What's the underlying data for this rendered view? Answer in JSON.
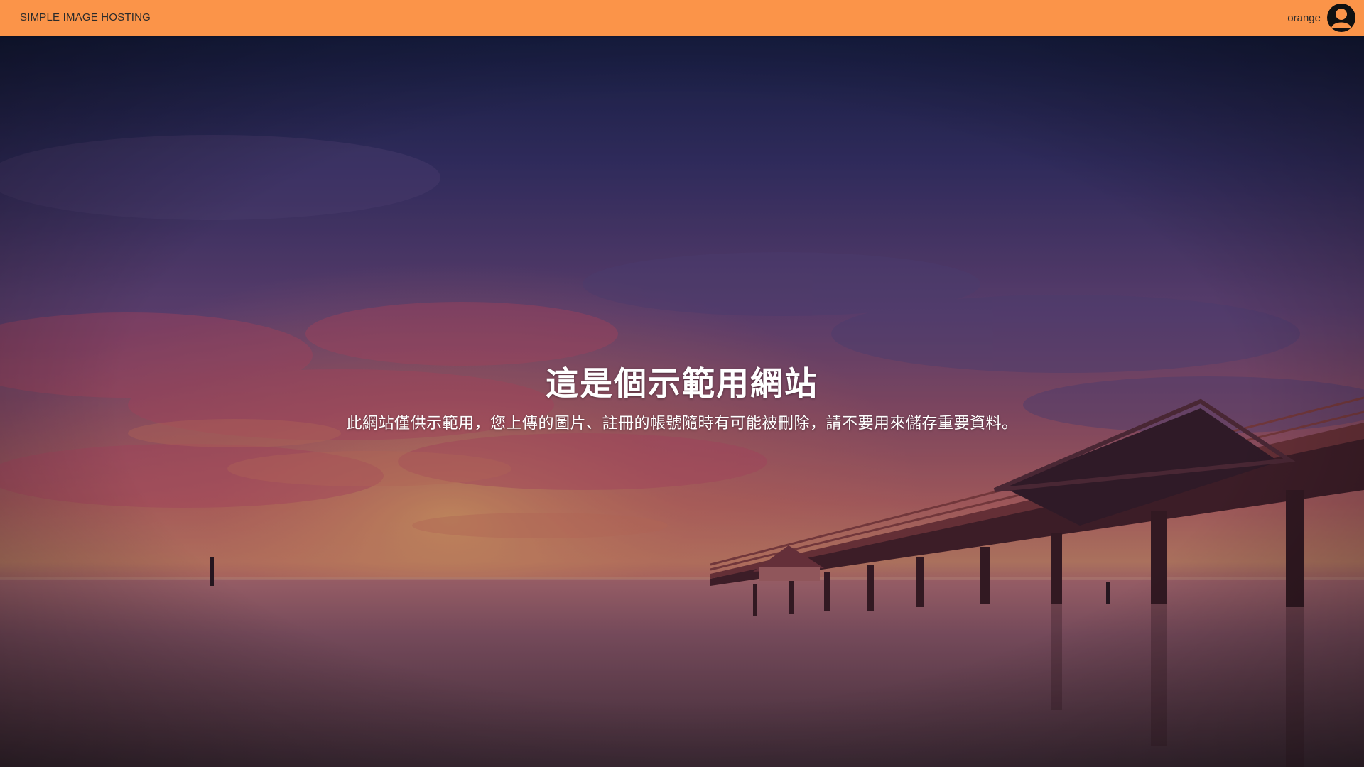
{
  "navbar": {
    "brand": "SIMPLE IMAGE HOSTING",
    "username": "orange",
    "avatar_icon": "user-avatar-icon",
    "background_color": "#fb9449"
  },
  "hero": {
    "title": "這是個示範用網站",
    "subtitle": "此網站僅供示範用，您上傳的圖片、註冊的帳號隨時有可能被刪除，請不要用來儲存重要資料。",
    "background_image": "sunset-pier-photo"
  }
}
